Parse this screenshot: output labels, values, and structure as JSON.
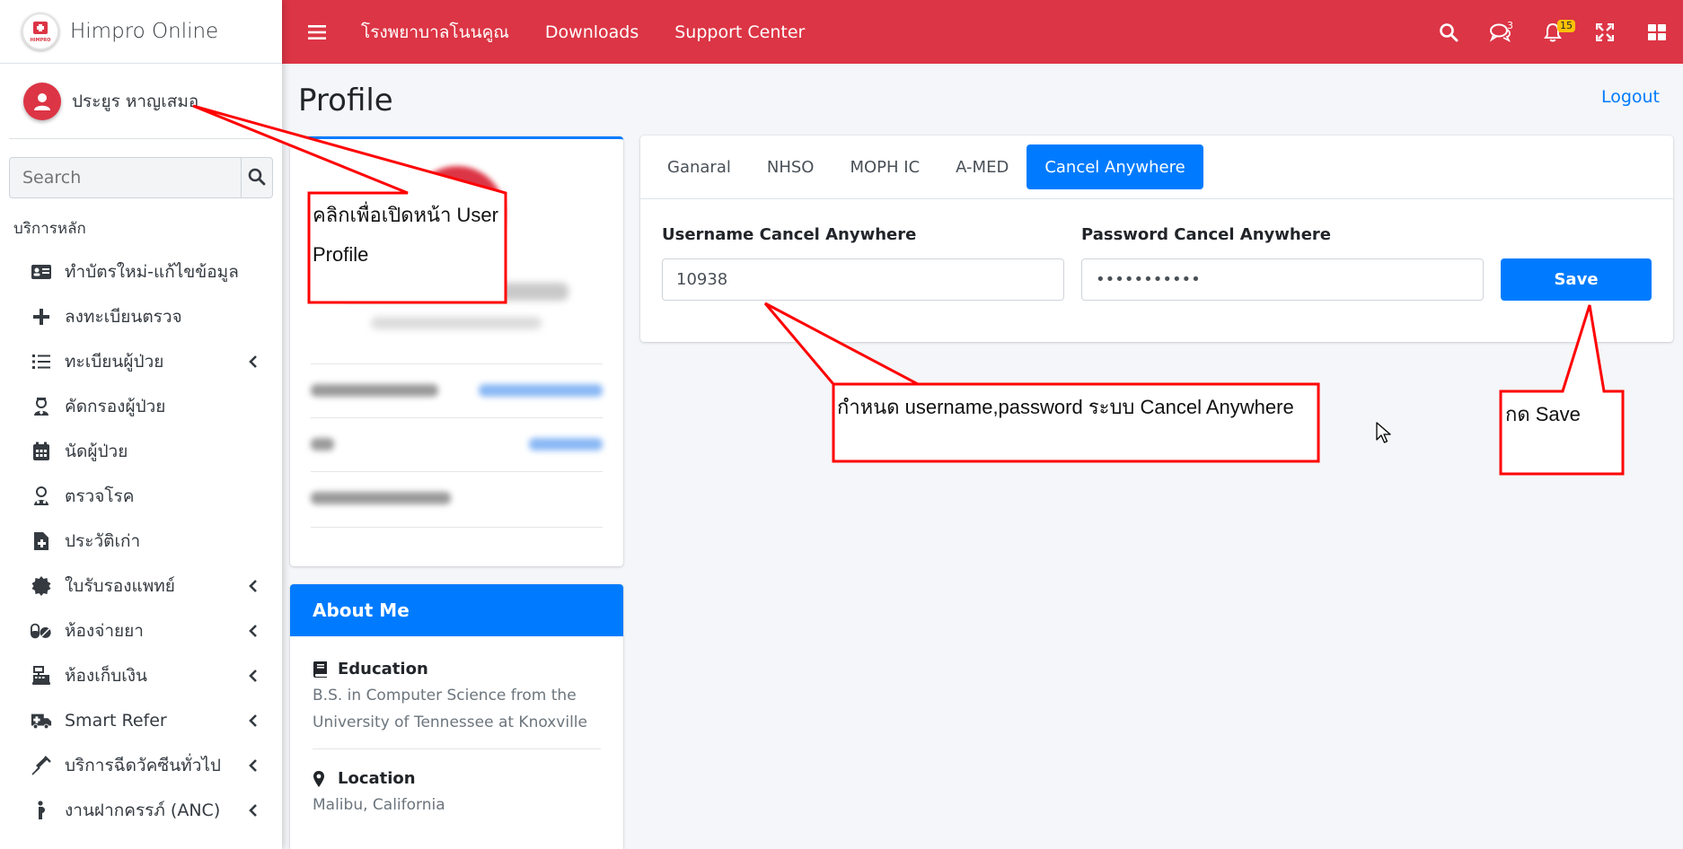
{
  "brand": {
    "name": "Himpro Online",
    "logo_text": "HIMPRO"
  },
  "user": {
    "name": "ประยูร หาญเสมอ"
  },
  "sidebar": {
    "search_placeholder": "Search",
    "section_header": "บริการหลัก",
    "items": [
      {
        "label": "ทำบัตรใหม่-แก้ไขข้อมูล",
        "icon": "id-card-icon",
        "has_submenu": false
      },
      {
        "label": "ลงทะเบียนตรวจ",
        "icon": "plus-icon",
        "has_submenu": false
      },
      {
        "label": "ทะเบียนผู้ป่วย",
        "icon": "list-icon",
        "has_submenu": true
      },
      {
        "label": "คัดกรองผู้ป่วย",
        "icon": "nurse-icon",
        "has_submenu": false
      },
      {
        "label": "นัดผู้ป่วย",
        "icon": "calendar-icon",
        "has_submenu": false
      },
      {
        "label": "ตรวจโรค",
        "icon": "doctor-icon",
        "has_submenu": false
      },
      {
        "label": "ประวัติเก่า",
        "icon": "file-medical-icon",
        "has_submenu": false
      },
      {
        "label": "ใบรับรองแพทย์",
        "icon": "certificate-icon",
        "has_submenu": true
      },
      {
        "label": "ห้องจ่ายยา",
        "icon": "pills-icon",
        "has_submenu": true
      },
      {
        "label": "ห้องเก็บเงิน",
        "icon": "cash-register-icon",
        "has_submenu": true
      },
      {
        "label": "Smart Refer",
        "icon": "ambulance-icon",
        "has_submenu": true
      },
      {
        "label": "บริการฉีดวัคซีนทั่วไป",
        "icon": "syringe-icon",
        "has_submenu": true
      },
      {
        "label": "งานฝากครรภ์ (ANC)",
        "icon": "pregnant-icon",
        "has_submenu": true
      }
    ]
  },
  "topbar": {
    "links": [
      "โรงพยาบาลโนนคูณ",
      "Downloads",
      "Support Center"
    ],
    "message_count": "3",
    "notification_count": "15"
  },
  "page": {
    "title": "Profile",
    "logout": "Logout"
  },
  "about": {
    "header": "About Me",
    "education_title": "Education",
    "education_text": "B.S. in Computer Science from the University of Tennessee at Knoxville",
    "location_title": "Location",
    "location_text": "Malibu, California"
  },
  "settings": {
    "tabs": [
      {
        "label": "Ganaral",
        "active": false
      },
      {
        "label": "NHSO",
        "active": false
      },
      {
        "label": "MOPH IC",
        "active": false
      },
      {
        "label": "A-MED",
        "active": false
      },
      {
        "label": "Cancel Anywhere",
        "active": true
      }
    ],
    "username_label": "Username Cancel Anywhere",
    "username_value": "10938",
    "password_label": "Password Cancel Anywhere",
    "password_value": "•••••••••••",
    "save_label": "Save"
  },
  "annotations": {
    "profile_note_line1": "คลิกเพื่อเปิดหน้า User",
    "profile_note_line2": "Profile",
    "credentials_note": "กำหนด username,password ระบบ Cancel Anywhere",
    "save_note": "กด Save"
  },
  "colors": {
    "topbar": "#dc3545",
    "primary": "#007bff",
    "annotation": "#ff0000"
  }
}
